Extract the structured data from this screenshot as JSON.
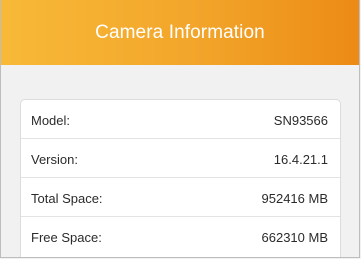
{
  "header": {
    "title": "Camera Information"
  },
  "info": {
    "rows": [
      {
        "label": "Model:",
        "value": "SN93566"
      },
      {
        "label": "Version:",
        "value": "16.4.21.1"
      },
      {
        "label": "Total Space:",
        "value": "952416 MB"
      },
      {
        "label": "Free Space:",
        "value": "662310 MB"
      }
    ]
  },
  "colors": {
    "header_gradient_start": "#f8b938",
    "header_gradient_end": "#ec8b16",
    "background": "#f1f1f1",
    "card": "#ffffff"
  }
}
